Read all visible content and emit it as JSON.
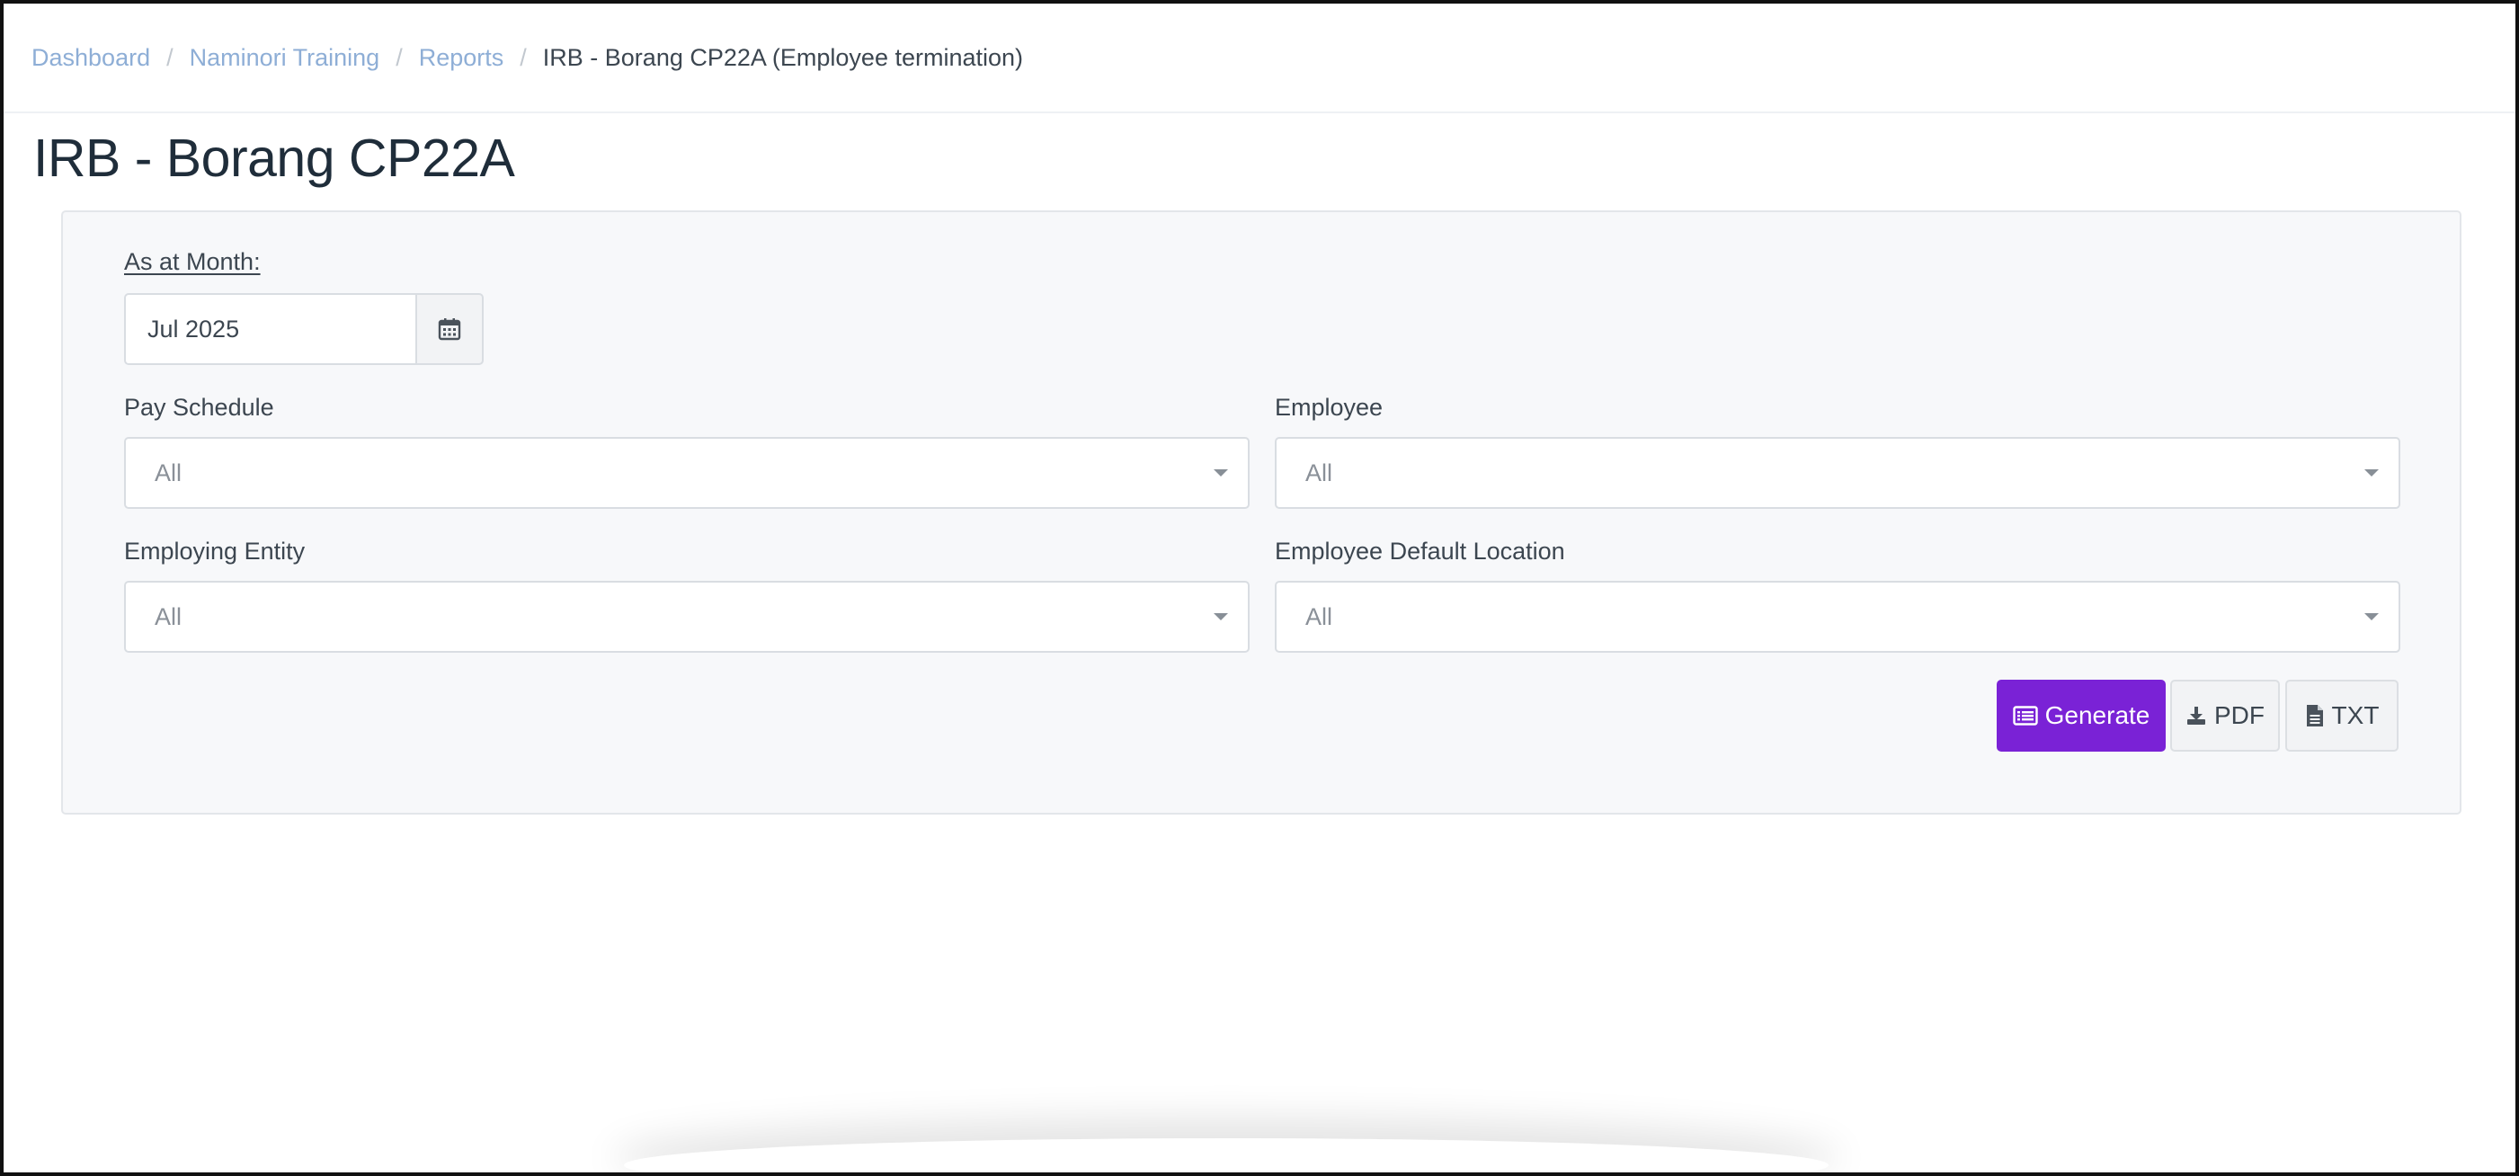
{
  "breadcrumb": {
    "items": [
      {
        "label": "Dashboard"
      },
      {
        "label": "Naminori Training"
      },
      {
        "label": "Reports"
      }
    ],
    "separator": "/",
    "current": "IRB - Borang CP22A (Employee termination)"
  },
  "page": {
    "title": "IRB - Borang CP22A"
  },
  "form": {
    "month": {
      "label": "As at Month:",
      "value": "Jul 2025",
      "icon": "calendar-icon"
    },
    "pay_schedule": {
      "label": "Pay Schedule",
      "value": "All"
    },
    "employee": {
      "label": "Employee",
      "value": "All"
    },
    "employing_entity": {
      "label": "Employing Entity",
      "value": "All"
    },
    "default_location": {
      "label": "Employee Default Location",
      "value": "All"
    }
  },
  "actions": {
    "generate": {
      "label": "Generate",
      "icon": "list-icon"
    },
    "pdf": {
      "label": "PDF",
      "icon": "download-icon"
    },
    "txt": {
      "label": "TXT",
      "icon": "file-text-icon"
    }
  },
  "colors": {
    "primary": "#7a22d6",
    "link": "#8eaed6",
    "panel_bg": "#f7f8fa",
    "text": "#2f3d4a"
  }
}
